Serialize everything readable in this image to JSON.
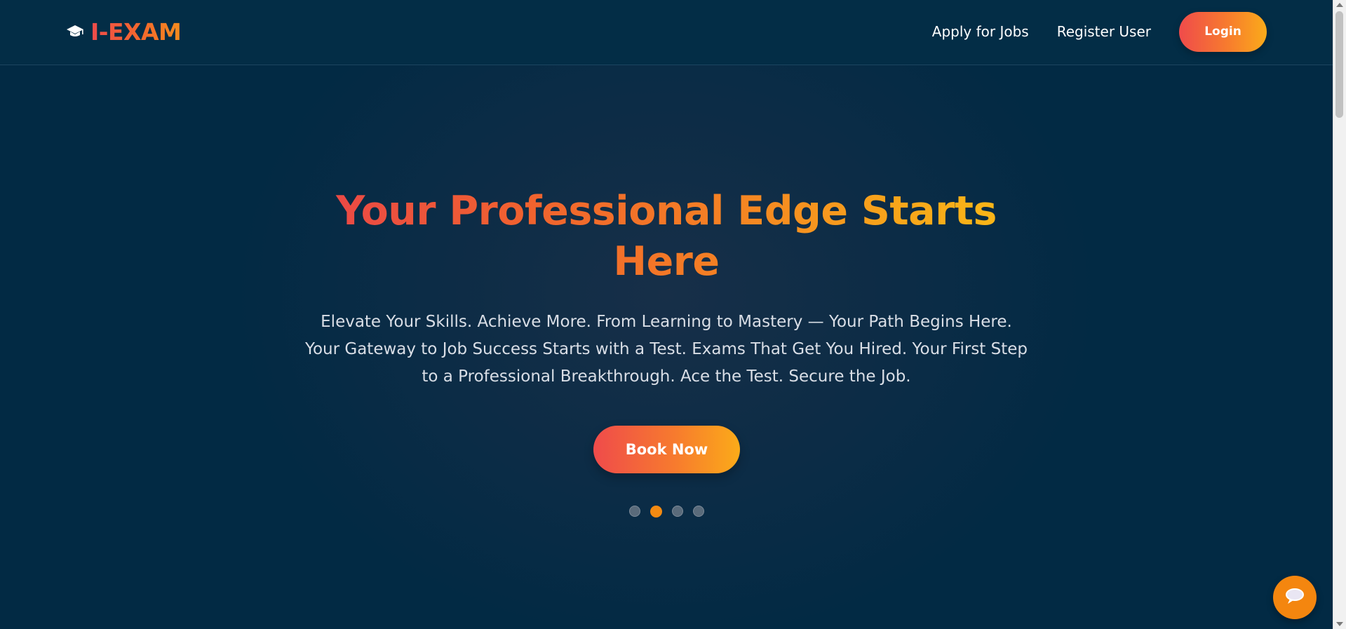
{
  "header": {
    "brand_name": "I-EXAM",
    "brand_icon": "graduation-cap-icon",
    "nav": [
      {
        "label": "Apply for Jobs"
      },
      {
        "label": "Register User"
      }
    ],
    "login_label": "Login"
  },
  "hero": {
    "title": "Your Professional Edge Starts Here",
    "subtitle": "Elevate Your Skills. Achieve More. From Learning to Mastery — Your Path Begins Here. Your Gateway to Job Success Starts with a Test. Exams That Get You Hired. Your First Step to a Professional Breakthrough. Ace the Test. Secure the Job.",
    "cta_label": "Book Now",
    "carousel": {
      "slide_count": 4,
      "active_index": 1
    }
  },
  "chat": {
    "icon": "chat-bubble-icon"
  },
  "colors": {
    "background": "#022b43",
    "accent_start": "#ef4b4b",
    "accent_end": "#fbab1a",
    "active_dot": "#f38a12",
    "chat_button": "#f4860f"
  }
}
